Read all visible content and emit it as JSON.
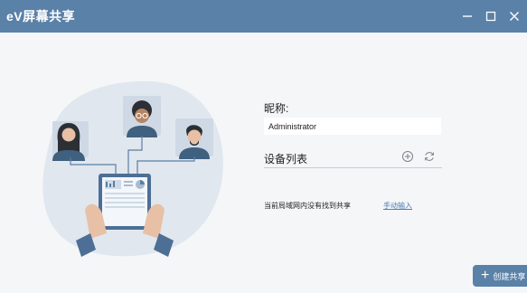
{
  "titlebar": {
    "title": "eV屏幕共享",
    "minimize": "minimize-icon",
    "maximize": "maximize-icon",
    "close": "close-icon"
  },
  "form": {
    "nickname_label": "昵称:",
    "nickname_value": "Administrator"
  },
  "device_list": {
    "title": "设备列表",
    "add_icon": "plus-circle-icon",
    "refresh_icon": "refresh-icon",
    "empty_text": "当前局域网内没有找到共享",
    "manual_link": "手动输入"
  },
  "actions": {
    "create_share": "创建共享"
  },
  "colors": {
    "titlebar": "#5a81a8",
    "background": "#f5f6f8",
    "link": "#4a7fb5",
    "illustration_blob": "#e1e7ef"
  }
}
